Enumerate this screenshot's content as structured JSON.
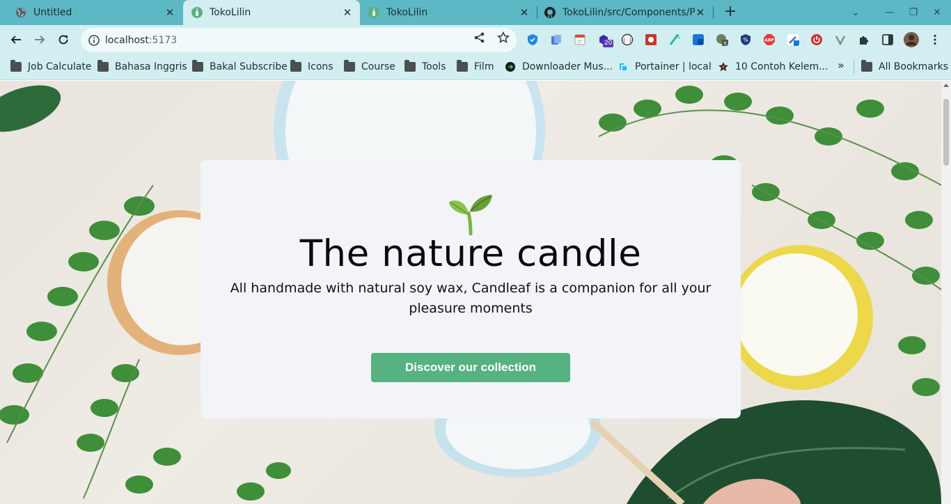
{
  "browser": {
    "tabs": [
      {
        "title": "Untitled",
        "active": false
      },
      {
        "title": "TokoLilin",
        "active": true
      },
      {
        "title": "TokoLilin",
        "active": false
      },
      {
        "title": "TokoLilin/src/Components/P",
        "active": false
      }
    ],
    "url_host": "localhost",
    "url_port": ":5173",
    "extension_badge": "20",
    "bookmarks": [
      {
        "label": "Job Calculate",
        "icon": "folder-icon"
      },
      {
        "label": "Bahasa Inggris",
        "icon": "folder-icon"
      },
      {
        "label": "Bakal Subscribe",
        "icon": "folder-icon"
      },
      {
        "label": "Icons",
        "icon": "folder-icon"
      },
      {
        "label": "Course",
        "icon": "folder-icon"
      },
      {
        "label": "Tools",
        "icon": "folder-icon"
      },
      {
        "label": "Film",
        "icon": "folder-icon"
      },
      {
        "label": "Downloader Mus...",
        "icon": "arrow-circle-icon"
      },
      {
        "label": "Portainer | local",
        "icon": "portainer-icon"
      },
      {
        "label": "10 Contoh Kelem...",
        "icon": "star-icon"
      }
    ],
    "bookmarks_more": "»",
    "all_bookmarks": "All Bookmarks"
  },
  "page": {
    "hero_title": "The nature candle",
    "hero_subtitle": "All handmade with natural soy wax, Candleaf is a companion for all your pleasure moments",
    "cta_label": "Discover our collection"
  },
  "colors": {
    "tab_strip": "#5cb8c4",
    "toolbar": "#d2eef1",
    "card": "#f2f4f8",
    "cta": "#56b280"
  }
}
